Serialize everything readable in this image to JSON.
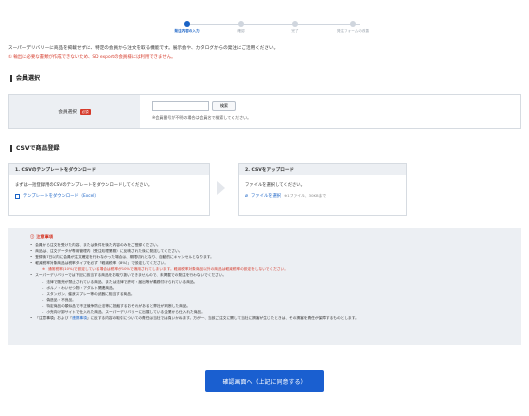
{
  "stepper": {
    "steps": [
      {
        "label": "発注内容の入力",
        "active": true
      },
      {
        "label": "確認",
        "active": false
      },
      {
        "label": "完了",
        "active": false
      },
      {
        "label": "発注フォームの改善",
        "active": false
      }
    ]
  },
  "intro_text": "スーパーデリバリーに商品を掲載せずに、特定の会員から注文を取る機能です。展示会や、カタログからの発注にご活用ください。",
  "warning_text": "① 輸出に必要な書類が作成できないため、SD exportの会員様には利用できません。",
  "member_section": {
    "heading": "会員選択",
    "label": "会員選択",
    "required_badge": "必須",
    "input_value": "",
    "search_button": "検索",
    "note": "※会員番号が不明の場合は会員名で検索してください。"
  },
  "csv_section": {
    "heading": "CSVで商品登録",
    "step1": {
      "title": "1. CSVのテンプレートをダウンロード",
      "body": "まずは一括登録用のCSVのテンプレートをダウンロードしてください。",
      "link": "テンプレートをダウンロード（Excel）"
    },
    "step2": {
      "title": "2. CSVをアップロード",
      "body": "ファイルを選択してください。",
      "link": "ファイルを選択",
      "limit": "※1ファイル、30KBまで"
    }
  },
  "notice": {
    "title": "注意事項",
    "items": [
      {
        "text": "会員から注文を受けた内容、または条件を後た内容のみをご登録ください。",
        "kind": "bullet"
      },
      {
        "text": "商品は、注文データが専用管理内（受注処理業務）に反映された後に発送してください。",
        "kind": "bullet"
      },
      {
        "text": "登録後7日以内に会員が注文確定を行わなかった場合は、期限切れとなり、自動的にキャンセルとなります。",
        "kind": "bullet"
      },
      {
        "text": "軽減税率対象商品は税率タイプを必ず「軽減税率（8%）」で設定してください。",
        "kind": "bullet"
      },
      {
        "text": "通常税率(10%)で設定している場合は税率が10%で適用されてしまいます。軽減税率対象商品以外の商品は軽減税率の設定をしないでください。",
        "kind": "red"
      },
      {
        "text": "スーパーデリバリーでは下記に該当する商品をお取り扱いできませんので、未掲載での発注を行わないでください。",
        "kind": "bullet"
      },
      {
        "text": "法律で販売が禁止されている商品、または法律で許可・届出等が義務付けられている商品。",
        "kind": "sub"
      },
      {
        "text": "ポルノ・わいせつ物・アダルト関連商品。",
        "kind": "sub"
      },
      {
        "text": "スタンガン、催涙スプレー等の武器に相当する商品。",
        "kind": "sub"
      },
      {
        "text": "偽造品・不良品。",
        "kind": "sub"
      },
      {
        "text": "特定商品の類似品で不正競争防止法等に抵触するおそれがあると弊社が判断した商品。",
        "kind": "sub"
      },
      {
        "text": "小売向け卸サイトで仕入れた商品、スーパーデリバリーに出展している企業から仕入れた商品。",
        "kind": "sub"
      }
    ],
    "last_line": {
      "prefix": "「注意事項」および「",
      "link": "連携事項",
      "suffix": "」に反する内容の取引についての責任は当社では負いかねます。万が一、当該ご注文に関して当社に損害が生じたときは、その損害を責任が保障するものとします。"
    }
  },
  "confirm_button": "確認画面へ（上記に同意する）"
}
